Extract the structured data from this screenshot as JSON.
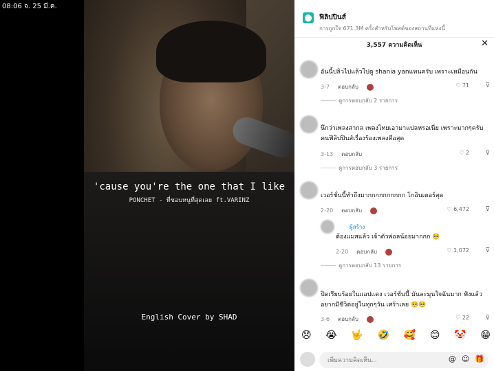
{
  "status": {
    "time": "08:06",
    "date": "จ. 25 มี.ค."
  },
  "video": {
    "lyric_line1": "'cause you're the one that I like",
    "lyric_line2": "PONCHET - ที่ชอบหนูที่สุดเลย ft.VARINZ",
    "cover_text": "English Cover by SHAD"
  },
  "panel": {
    "place_name": "ฟิลิปปินส์",
    "place_sub": "การถูกใจ 671.3M ครั้งสำหรับโพสต์ของสถานที่แห่งนี้",
    "comment_count": "3,557 ความคิดเห็น",
    "close": "✕",
    "reply_label": "ตอบกลับ",
    "creator_label": "ผู้สร้าง",
    "comments": [
      {
        "text": "อันนี้ปลิวไปแล้วไปดู shania yanแทนครับ เพราะเหมือนกัน",
        "date": "3-7",
        "likes": "71",
        "more": "ดูการตอบกลับ 2 รายการ"
      },
      {
        "text": "นึกว่าเพลงสากล เพลงไทยเอามาแปลหรอเนี่ย เพราะมากๆครับ คนฟิลิปปินส์เรื่องร้องเพลงคือสุด",
        "date": "3-13",
        "likes": "2",
        "more": "ดูการตอบกลับ 3 รายการ"
      },
      {
        "text": "เวอร์ชั่นนี้ทำถึงมากกกกกกกกกก โกอินเตอร์สุด",
        "date": "2-20",
        "likes": "6,472"
      },
      {
        "text": "ต้องแมสแล้ว เจ้าตัวพ่อลน้อยมากกก 🥺",
        "date": "2-20",
        "likes": "1,072",
        "more": "ดูการตอบกลับ 13 รายการ"
      },
      {
        "text": "ปิดเรียบร้อยในแอปแดง เวอร์ชั่นนี้ มันละมุนใจฉันมาก ฟังแล้วอยากมีชีวิตอยู่ในทุกๆวัน เศร้าเลย 🥺🥺",
        "date": "3-6",
        "likes": "22"
      }
    ],
    "emojis": [
      "😞",
      "😭",
      "🤟",
      "🤣",
      "🥰",
      "😊",
      "🤡",
      "😁"
    ],
    "input_placeholder": "เพิ่มความคิดเห็น...",
    "icon_at": "@",
    "icon_emoji": "☺",
    "icon_gift": "🎁"
  }
}
